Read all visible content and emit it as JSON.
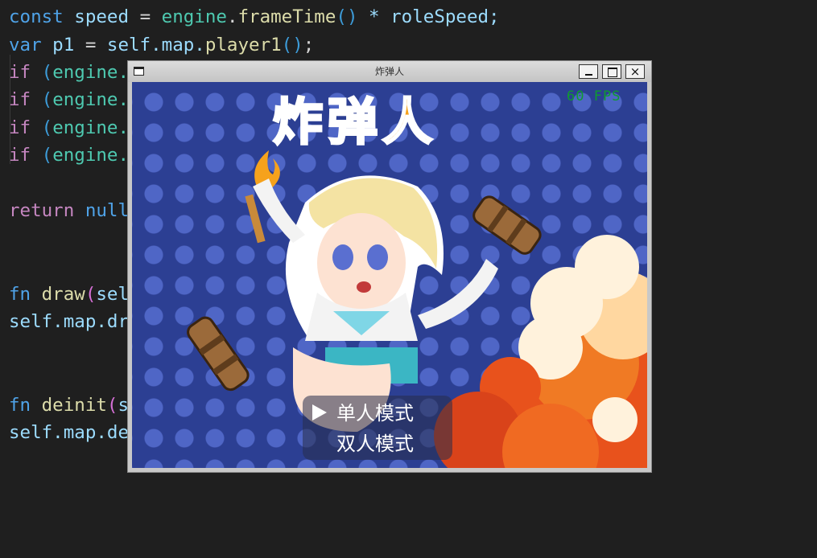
{
  "editor": {
    "lines": {
      "l1": {
        "kw": "const",
        "a": " speed ",
        "eq": "=",
        "b": " engine",
        "c": ".",
        "fn": "frameTime",
        "p": "()",
        "d": " * roleSpeed;"
      },
      "l2": {
        "kw": "var",
        "a": " p1 ",
        "eq": "=",
        "b": " self.map.",
        "fn": "player1",
        "p": "()",
        "d": ";"
      },
      "l3": {
        "kw": "if",
        "a": " ",
        "p": "(",
        "b": "engine."
      },
      "l4": {
        "kw": "if",
        "a": " ",
        "p": "(",
        "b": "engine."
      },
      "l5": {
        "kw": "if",
        "a": " ",
        "p": "(",
        "b": "engine."
      },
      "l6": {
        "kw": "if",
        "a": " ",
        "p": "(",
        "b": "engine."
      },
      "l7": {
        "kw": "return",
        "b": " null"
      },
      "l8": {
        "kw": "fn",
        "a": " ",
        "fn": "draw",
        "p": "(",
        "b": "sel"
      },
      "l9": {
        "b": "self.map.dr"
      },
      "l10": {
        "kw": "fn",
        "a": " ",
        "fn": "deinit",
        "p": "(",
        "b": "s"
      },
      "l11": {
        "b": "self.map.de"
      }
    }
  },
  "window": {
    "title": "炸弹人",
    "close_glyph": "×"
  },
  "game": {
    "fps": "60 FPS",
    "logo": {
      "c1": "炸",
      "c2": "弹",
      "c3": "人"
    },
    "menu": [
      {
        "label": "单人模式",
        "selected": true
      },
      {
        "label": "双人模式",
        "selected": false
      }
    ]
  },
  "colors": {
    "editor_bg": "#1f1f1f",
    "game_bg": "#2c3f93",
    "fps": "#0f9b30",
    "logo_orange": "#f06a22",
    "logo_green": "#4ed13c"
  }
}
